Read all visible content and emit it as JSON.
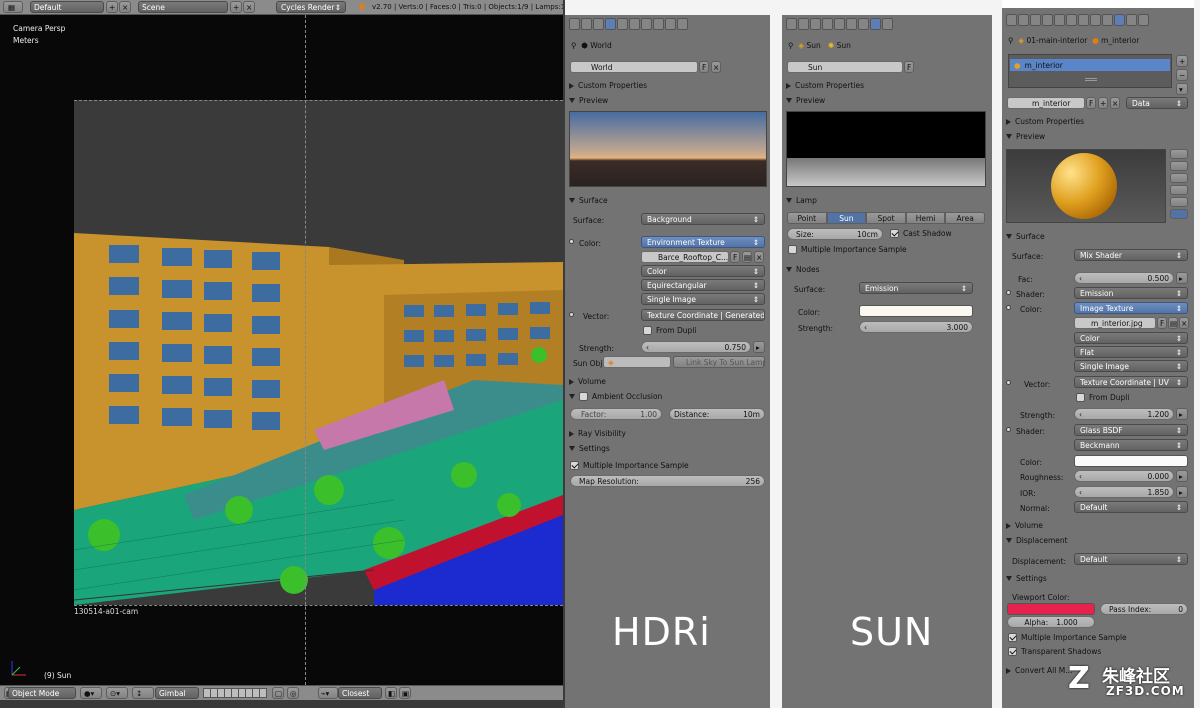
{
  "header": {
    "layout": "Default",
    "scene": "Scene",
    "engine": "Cycles Render",
    "stats": "v2.70 | Verts:0 | Faces:0 | Tris:0 | Objects:1/9 | Lamps:1/1 | M"
  },
  "viewport": {
    "view": "Camera Persp",
    "units": "Meters",
    "cam_name": "130514-a01-cam",
    "obj_label": "(9) Sun"
  },
  "viewport_footer": {
    "mode": "Object Mode",
    "pivot": "Gimbal",
    "snap": "Closest"
  },
  "hdri": {
    "context": "World",
    "datablock": "World",
    "custom_props": "Custom Properties",
    "preview": "Preview",
    "surface_panel": "Surface",
    "surface_label": "Surface:",
    "surface_value": "Background",
    "color_label": "Color:",
    "color_value": "Environment Texture",
    "image_name": "Barce_Rooftop_C...",
    "opt1": "Color",
    "opt2": "Equirectangular",
    "opt3": "Single Image",
    "vector_label": "Vector:",
    "vector_value": "Texture Coordinate | Generated",
    "from_dupli": "From Dupli",
    "strength_label": "Strength:",
    "strength_value": "0.750",
    "sunobj_label": "Sun Obj:",
    "sunobj_btn": "Link Sky To Sun Lamp",
    "volume": "Volume",
    "ao": "Ambient Occlusion",
    "factor_label": "Factor:",
    "factor_value": "1.00",
    "distance_label": "Distance:",
    "distance_value": "10m",
    "ray": "Ray Visibility",
    "settings": "Settings",
    "mis": "Multiple Importance Sample",
    "mapres_label": "Map Resolution:",
    "mapres_value": "256",
    "caption": "HDRi"
  },
  "sun": {
    "ctx1": "Sun",
    "ctx2": "Sun",
    "datablock": "Sun",
    "custom_props": "Custom Properties",
    "preview": "Preview",
    "lamp_panel": "Lamp",
    "types": [
      "Point",
      "Sun",
      "Spot",
      "Hemi",
      "Area"
    ],
    "active_type": "Sun",
    "size_label": "Size:",
    "size_value": "10cm",
    "cast_shadow": "Cast Shadow",
    "mis": "Multiple Importance Sample",
    "nodes": "Nodes",
    "surface_label": "Surface:",
    "surface_value": "Emission",
    "color_label": "Color:",
    "strength_label": "Strength:",
    "strength_value": "3.000",
    "caption": "SUN"
  },
  "mat": {
    "ctx1": "01-main-interior",
    "ctx2": "m_interior",
    "slot": "m_interior",
    "datablock": "m_interior",
    "link": "Data",
    "custom_props": "Custom Properties",
    "preview": "Preview",
    "surface_panel": "Surface",
    "surface_label": "Surface:",
    "surface_value": "Mix Shader",
    "fac_label": "Fac:",
    "fac_value": "0.500",
    "shader_label": "Shader:",
    "shader1": "Emission",
    "color_label": "Color:",
    "color_value": "Image Texture",
    "image_name": "m_interior.jpg",
    "opt1": "Color",
    "opt2": "Flat",
    "opt3": "Single Image",
    "vector_label": "Vector:",
    "vector_value": "Texture Coordinate | UV",
    "from_dupli": "From Dupli",
    "strength_label": "Strength:",
    "strength_value": "1.200",
    "shader2": "Glass BSDF",
    "dist": "Beckmann",
    "color2_label": "Color:",
    "rough_label": "Roughness:",
    "rough_value": "0.000",
    "ior_label": "IOR:",
    "ior_value": "1.850",
    "normal_label": "Normal:",
    "normal_value": "Default",
    "volume": "Volume",
    "displacement": "Displacement",
    "disp_label": "Displacement:",
    "disp_value": "Default",
    "settings": "Settings",
    "vpcolor": "Viewport Color:",
    "passidx_label": "Pass Index:",
    "passidx_value": "0",
    "alpha_label": "Alpha:",
    "alpha_value": "1.000",
    "mis": "Multiple Importance Sample",
    "transp": "Transparent Shadows",
    "convert": "Convert All M..."
  },
  "watermark": {
    "cn": "朱峰社区",
    "en": "ZF3D.COM"
  },
  "colors": {
    "panel": "#737373",
    "blue": "#5273a6",
    "vp_color": "#e8224f"
  }
}
